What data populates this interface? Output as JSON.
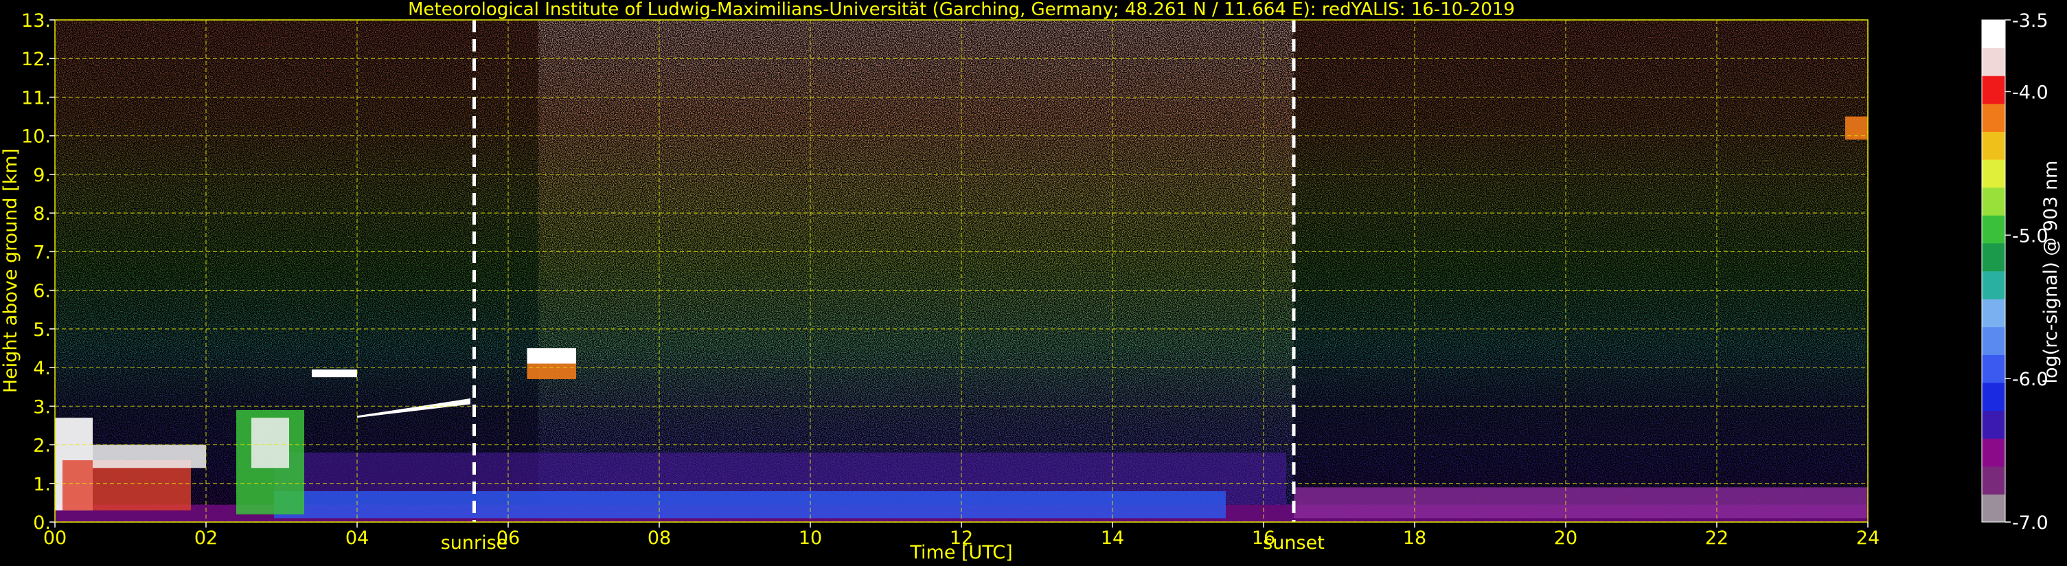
{
  "chart_data": {
    "type": "heatmap",
    "title": "Meteorological Institute of Ludwig-Maximilians-Universität (Garching, Germany; 48.261 N / 11.664 E):    redYALIS: 16-10-2019",
    "xlabel": "Time [UTC]",
    "ylabel": "Height above ground [km]",
    "xlim": [
      0,
      24
    ],
    "ylim": [
      0,
      13
    ],
    "x_ticks": [
      {
        "value": 0,
        "label": "00"
      },
      {
        "value": 2,
        "label": "02"
      },
      {
        "value": 4,
        "label": "04"
      },
      {
        "value": 6,
        "label": "06"
      },
      {
        "value": 8,
        "label": "08"
      },
      {
        "value": 10,
        "label": "10"
      },
      {
        "value": 12,
        "label": "12"
      },
      {
        "value": 14,
        "label": "14"
      },
      {
        "value": 16,
        "label": "16"
      },
      {
        "value": 18,
        "label": "18"
      },
      {
        "value": 20,
        "label": "20"
      },
      {
        "value": 22,
        "label": "22"
      },
      {
        "value": 24,
        "label": "24"
      }
    ],
    "y_ticks": [
      {
        "value": 0,
        "label": "0."
      },
      {
        "value": 1,
        "label": "1."
      },
      {
        "value": 2,
        "label": "2."
      },
      {
        "value": 3,
        "label": "3."
      },
      {
        "value": 4,
        "label": "4."
      },
      {
        "value": 5,
        "label": "5."
      },
      {
        "value": 6,
        "label": "6."
      },
      {
        "value": 7,
        "label": "7."
      },
      {
        "value": 8,
        "label": "8."
      },
      {
        "value": 9,
        "label": "9."
      },
      {
        "value": 10,
        "label": "10."
      },
      {
        "value": 11,
        "label": "11."
      },
      {
        "value": 12,
        "label": "12."
      },
      {
        "value": 13,
        "label": "13."
      }
    ],
    "grid": true,
    "grid_color": "#e6e600",
    "axis_text_color": "#ffff00",
    "markers": [
      {
        "label": "sunrise",
        "time": 5.55
      },
      {
        "label": "sunset",
        "time": 16.4
      }
    ],
    "colorbar": {
      "label": "log(rc-signal) @ 903 nm",
      "range": [
        -7.0,
        -3.5
      ],
      "ticks": [
        {
          "value": -3.5,
          "label": "-3.5"
        },
        {
          "value": -4.0,
          "label": "-4.0"
        },
        {
          "value": -5.0,
          "label": "-5.0"
        },
        {
          "value": -6.0,
          "label": "-6.0"
        },
        {
          "value": -7.0,
          "label": "-7.0"
        }
      ],
      "colors": [
        "#9a8f9a",
        "#7a2a7a",
        "#8a0a8a",
        "#3a1ab0",
        "#1a2ae0",
        "#3a5af0",
        "#5a8af0",
        "#7ab0f0",
        "#2ab0a0",
        "#1a9a4a",
        "#3ac03a",
        "#9ae03a",
        "#e0f03a",
        "#f0c01a",
        "#f07a1a",
        "#f01a1a",
        "#f0d8d8",
        "#ffffff"
      ]
    }
  }
}
